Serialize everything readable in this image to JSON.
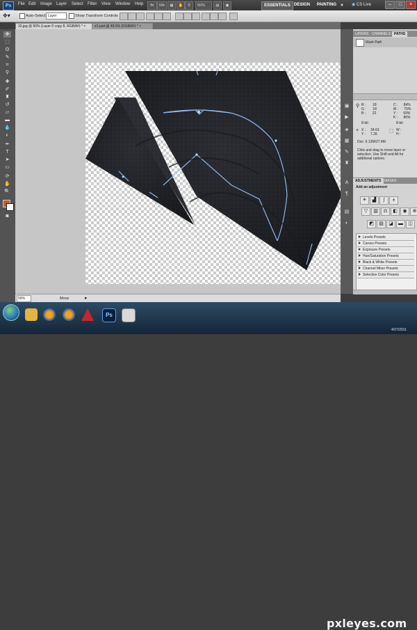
{
  "menubar": {
    "app_badge": "Ps",
    "items": [
      "File",
      "Edit",
      "Image",
      "Layer",
      "Select",
      "Filter",
      "View",
      "Window",
      "Help"
    ],
    "zoom": "50%",
    "workspaces": [
      "ESSENTIALS",
      "DESIGN",
      "PAINTING"
    ],
    "cs_live": "CS Live"
  },
  "options": {
    "auto_select_label": "Auto-Select:",
    "auto_select_value": "Layer",
    "transform_label": "Show Transform Controls"
  },
  "tabs": [
    {
      "label": "33.jpg @ 50% (Layer 0 copy 8, RGB/8#) *"
    },
    {
      "label": "e1.psd @ 49.6% (RGB/8#) *"
    }
  ],
  "panels": {
    "top_tabs": [
      "LAYERS",
      "CHANNELS",
      "PATHS"
    ],
    "path_item": "Work Path",
    "info": {
      "rgb": [
        [
          "R :",
          "18"
        ],
        [
          "G :",
          "18"
        ],
        [
          "B :",
          "22"
        ]
      ],
      "cmyk": [
        [
          "C :",
          "84%"
        ],
        [
          "M :",
          "75%"
        ],
        [
          "Y :",
          "69%"
        ],
        [
          "K :",
          "86%"
        ]
      ],
      "bits_left": "8-bit",
      "bits_right": "8-bit",
      "xy": [
        [
          "X :",
          "34.63"
        ],
        [
          "Y :",
          "7.26"
        ]
      ],
      "wh": [
        [
          "W :",
          ""
        ],
        [
          "H :",
          ""
        ]
      ],
      "doc": "Doc: 6.12M/27.4M",
      "hint": "Click and drag to move layer or selection. Use Shift and Alt for additional options."
    },
    "adj_tabs": [
      "ADJUSTMENTS",
      "MASKS"
    ],
    "adj_title": "Add an adjustment",
    "presets": [
      "Levels Presets",
      "Curves Presets",
      "Exposure Presets",
      "Hue/Saturation Presets",
      "Black & White Presets",
      "Channel Mixer Presets",
      "Selective Color Presets"
    ]
  },
  "status": {
    "zoom": "50%",
    "tool": "Move"
  },
  "taskbar": {
    "time": "",
    "date": "4/27/2011"
  },
  "watermark": "pxleyes.com",
  "colors": {
    "fg_swatch": "#c25a2e",
    "bg_swatch": "#ffffff"
  }
}
